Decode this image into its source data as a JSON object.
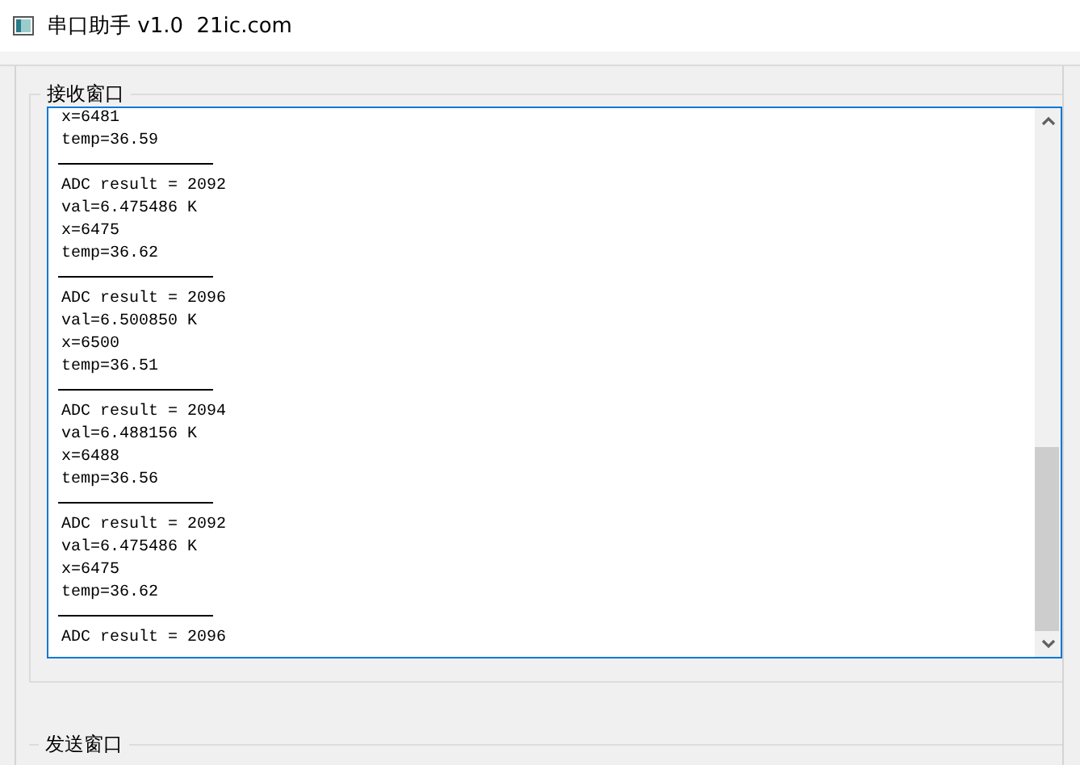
{
  "window": {
    "title": "串口助手 v1.0  21ic.com"
  },
  "receive": {
    "label": "接收窗口",
    "lines": [
      {
        "kind": "text",
        "text": "x=6481"
      },
      {
        "kind": "text",
        "text": "temp=36.59"
      },
      {
        "kind": "rule"
      },
      {
        "kind": "text",
        "text": "ADC result = 2092"
      },
      {
        "kind": "text",
        "text": "val=6.475486 K"
      },
      {
        "kind": "text",
        "text": "x=6475"
      },
      {
        "kind": "text",
        "text": "temp=36.62"
      },
      {
        "kind": "rule"
      },
      {
        "kind": "text",
        "text": "ADC result = 2096"
      },
      {
        "kind": "text",
        "text": "val=6.500850 K"
      },
      {
        "kind": "text",
        "text": "x=6500"
      },
      {
        "kind": "text",
        "text": "temp=36.51"
      },
      {
        "kind": "rule"
      },
      {
        "kind": "text",
        "text": "ADC result = 2094"
      },
      {
        "kind": "text",
        "text": "val=6.488156 K"
      },
      {
        "kind": "text",
        "text": "x=6488"
      },
      {
        "kind": "text",
        "text": "temp=36.56"
      },
      {
        "kind": "rule"
      },
      {
        "kind": "text",
        "text": "ADC result = 2092"
      },
      {
        "kind": "text",
        "text": "val=6.475486 K"
      },
      {
        "kind": "text",
        "text": "x=6475"
      },
      {
        "kind": "text",
        "text": "temp=36.62"
      },
      {
        "kind": "rule"
      },
      {
        "kind": "text",
        "text": "ADC result = 2096"
      }
    ]
  },
  "send": {
    "label": "发送窗口"
  }
}
